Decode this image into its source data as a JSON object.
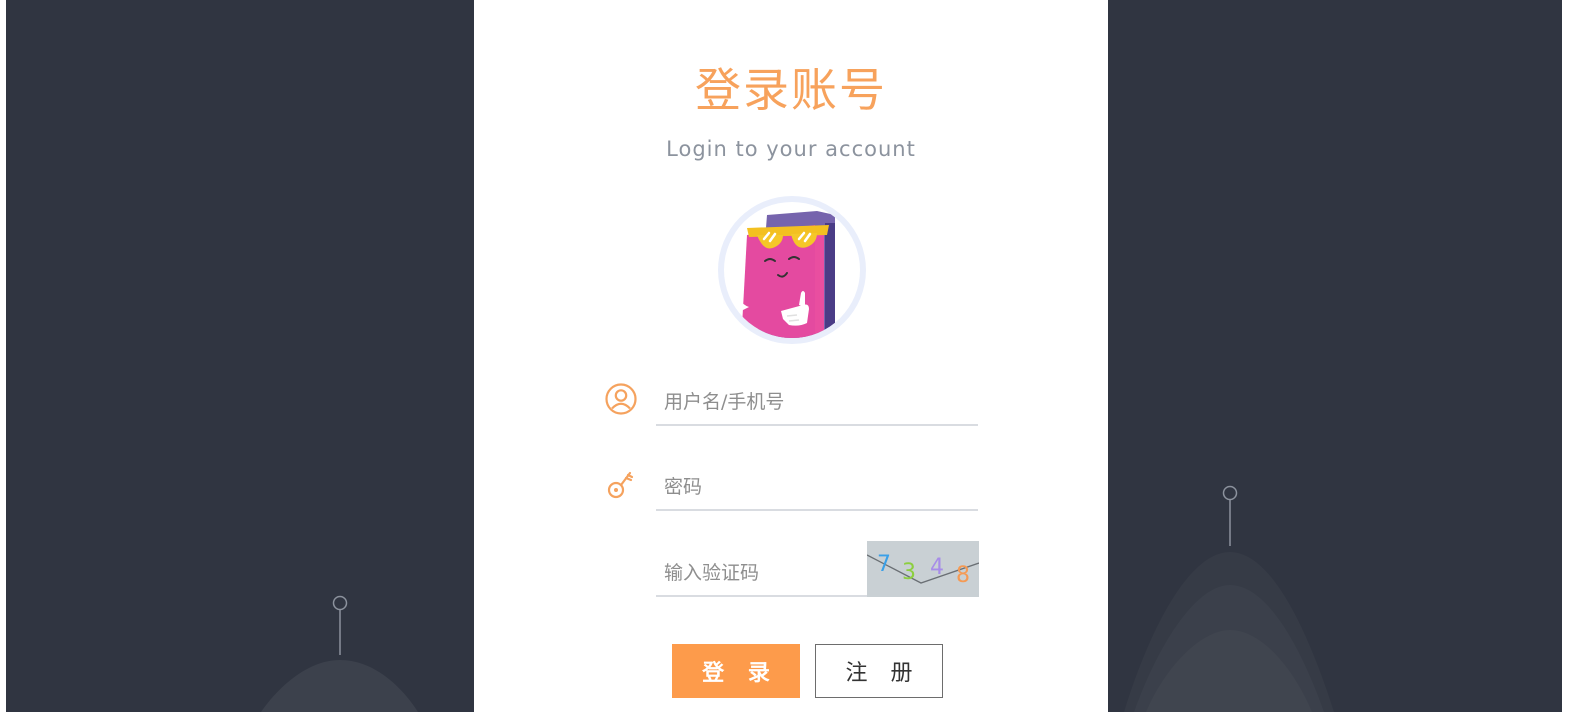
{
  "login": {
    "title": "登录账号",
    "subtitle": "Login to your account",
    "username_placeholder": "用户名/手机号",
    "password_placeholder": "密码",
    "captcha_placeholder": "输入验证码",
    "captcha_chars": [
      "7",
      "3",
      "4",
      "8"
    ],
    "login_button": "登 录",
    "register_button": "注 册"
  },
  "icons": {
    "username": "user-circle-icon",
    "password": "key-icon",
    "avatar": "book-character-avatar"
  },
  "colors": {
    "accent": "#fd9b4b",
    "title": "#f7a25c",
    "background": "#303541",
    "card": "#ffffff",
    "captcha_bg": "#c9d0d4",
    "captcha_chars": [
      "#3aa0e8",
      "#8ccf3f",
      "#a78ce8",
      "#f59a54"
    ]
  }
}
